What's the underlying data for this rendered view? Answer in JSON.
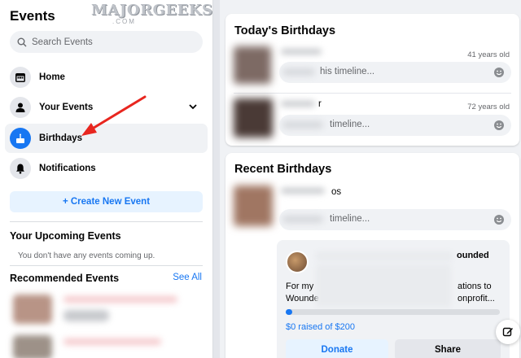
{
  "watermark": {
    "text": "MAJORGEEKS",
    "stars": ".COM"
  },
  "sidebar": {
    "title": "Events",
    "search_placeholder": "Search Events",
    "nav": [
      {
        "label": "Home",
        "icon": "calendar-icon"
      },
      {
        "label": "Your Events",
        "icon": "person-icon"
      },
      {
        "label": "Birthdays",
        "icon": "birthday-cake-icon"
      },
      {
        "label": "Notifications",
        "icon": "bell-icon"
      }
    ],
    "create_button": "+ Create New Event",
    "upcoming_title": "Your Upcoming Events",
    "upcoming_empty": "You don't have any events coming up.",
    "recommended_title": "Recommended Events",
    "see_all": "See All"
  },
  "todays_birthdays": {
    "title": "Today's Birthdays",
    "people": [
      {
        "age": "41 years old",
        "input_tail": "his timeline..."
      },
      {
        "name_tail": "r",
        "age": "72 years old",
        "input_tail": "timeline..."
      }
    ]
  },
  "recent_birthdays": {
    "title": "Recent Birthdays",
    "person": {
      "name_tail": "os",
      "input_tail": "timeline..."
    },
    "donation": {
      "title_tail": "ounded",
      "line1_start": "For my",
      "line1_end": "ations to",
      "line2_start": "Wounde",
      "line2_end": "onprofit...",
      "progress": 0.01,
      "raised": "$0 raised of $200",
      "donate": "Donate",
      "share": "Share"
    }
  },
  "colors": {
    "accent": "#1877f2",
    "annotation_arrow": "#e8261f"
  }
}
